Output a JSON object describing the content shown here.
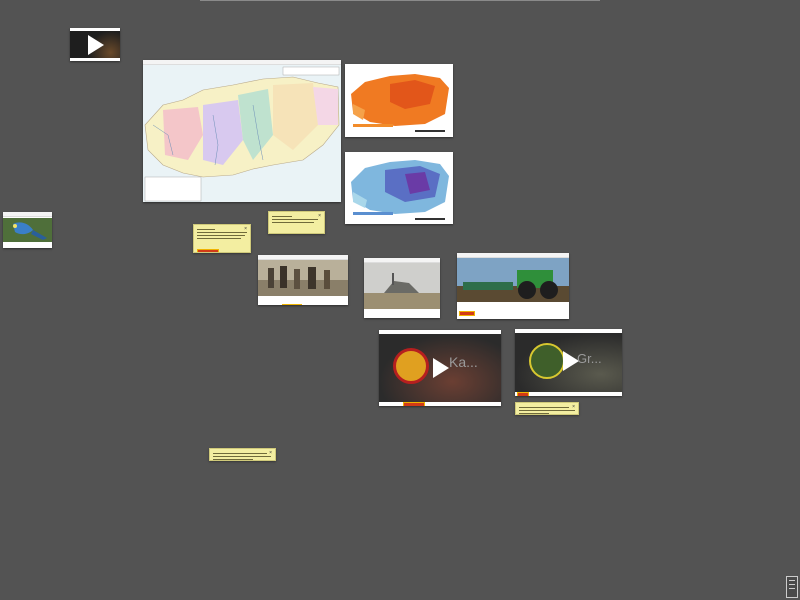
{
  "canvas": {
    "background": "#535353"
  },
  "cards": {
    "video_top": {
      "icon": "play-icon"
    },
    "russia_map": {
      "header": "",
      "source": "",
      "date": ""
    },
    "temp_map_1": {
      "source": ""
    },
    "temp_map_2": {
      "source": ""
    },
    "parrot": {
      "source": ""
    },
    "painting": {
      "source": "",
      "date": ""
    },
    "harvest_photo": {
      "source": "",
      "date": ""
    },
    "tractor_photo": {
      "source": "",
      "date": ""
    },
    "video_ussr": {
      "title": "Ka...",
      "source": ""
    },
    "video_deere": {
      "title": "Gr..."
    }
  },
  "notes": [
    {
      "id": "note-1"
    },
    {
      "id": "note-2"
    },
    {
      "id": "note-3"
    },
    {
      "id": "note-4"
    }
  ],
  "colors": {
    "note_bg": "#f3eea1",
    "highlight": "#d23a17",
    "video_bg": "#2b2b2b"
  }
}
